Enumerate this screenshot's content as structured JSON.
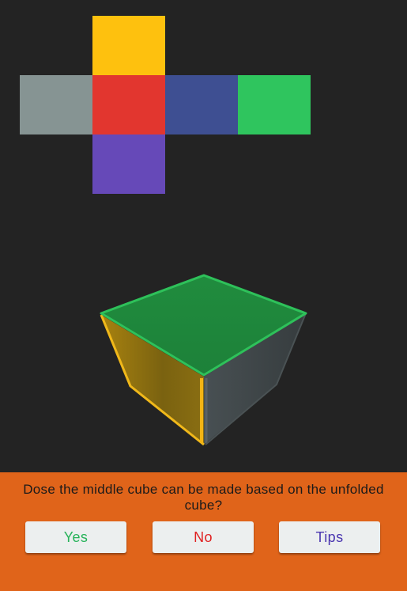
{
  "net": {
    "faces": [
      {
        "id": "top",
        "color": "#fec10e"
      },
      {
        "id": "left",
        "color": "#869493"
      },
      {
        "id": "center",
        "color": "#e2362f"
      },
      {
        "id": "right",
        "color": "#3e4f92"
      },
      {
        "id": "far-right",
        "color": "#2fc55e"
      },
      {
        "id": "bottom",
        "color": "#6649b8"
      }
    ]
  },
  "cube": {
    "top_color": "#1f8a3d",
    "left_color": "#7a6210",
    "right_color": "#3a4244"
  },
  "question": {
    "text": "Dose the middle cube can be made based on the unfolded cube?"
  },
  "buttons": {
    "yes": {
      "label": "Yes",
      "color": "#27b35a"
    },
    "no": {
      "label": "No",
      "color": "#e02222"
    },
    "tips": {
      "label": "Tips",
      "color": "#4a36b0"
    }
  },
  "colors": {
    "background": "#232323",
    "panel": "#e0641a"
  }
}
